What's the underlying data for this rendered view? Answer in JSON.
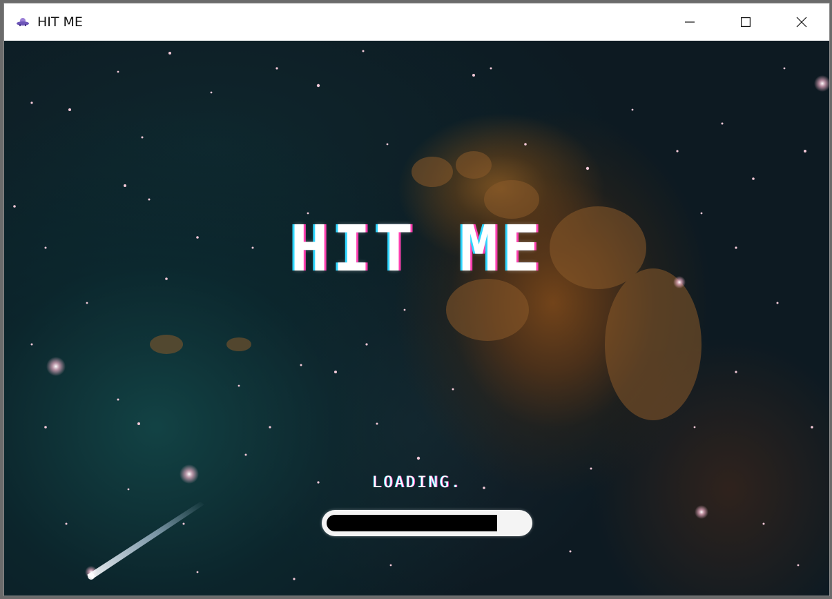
{
  "window": {
    "title": "HIT ME",
    "icon": "alien-ship-icon",
    "controls": [
      "minimize-icon",
      "maximize-icon",
      "close-icon"
    ]
  },
  "game": {
    "title": "HIT ME",
    "loading_label": "LOADING.",
    "progress_fraction": 0.85
  },
  "colors": {
    "title_text": "#ffffff",
    "title_glitch_cyan": "#2fd6ff",
    "title_glitch_magenta": "#ff3fb0",
    "progress_track": "#f4f4f4",
    "progress_fill": "#000000"
  }
}
